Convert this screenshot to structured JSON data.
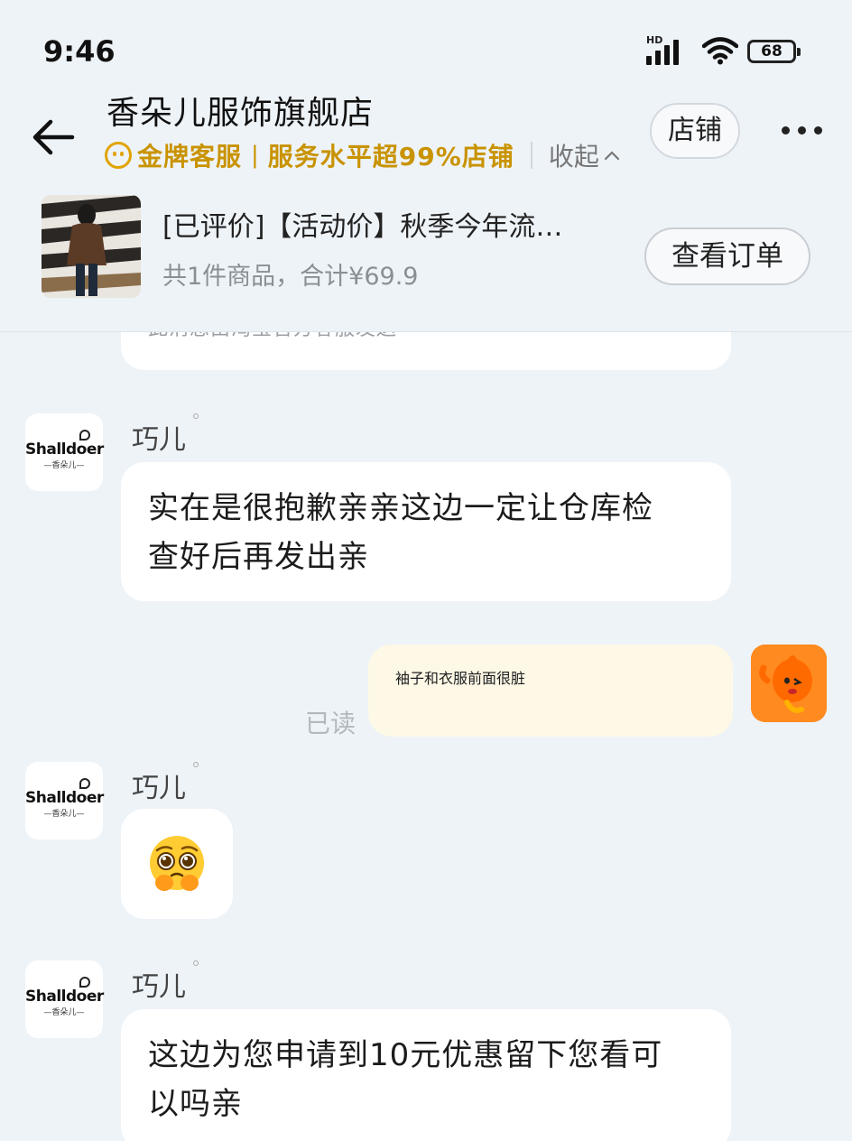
{
  "status_bar": {
    "time": "9:46",
    "network_label": "HD",
    "battery": "68"
  },
  "header": {
    "shop_name": "香朵儿服饰旗舰店",
    "badge_primary": "金牌客服",
    "badge_separator": "|",
    "badge_secondary": "服务水平超99%店铺",
    "collapse_label": "收起",
    "store_button": "店铺"
  },
  "order": {
    "title": "[已评价]【活动价】秋季今年流…",
    "summary": "共1件商品，合计¥69.9",
    "view_button": "查看订单"
  },
  "chat": {
    "notice_partial": "此消息由淘宝官方客服发送",
    "shop_avatar_brand": "Shalldoer",
    "shop_avatar_sub": "—香朵儿—",
    "messages": [
      {
        "sender": "巧儿",
        "lines": [
          "实在是很抱歉亲亲这边一定让仓库检",
          "查好后再发出亲"
        ]
      },
      {
        "sender": "me",
        "text": "袖子和衣服前面很脏",
        "status": "已读"
      },
      {
        "sender": "巧儿",
        "emoji": "pleading-face"
      },
      {
        "sender": "巧儿",
        "lines": [
          "这边为您申请到10元优惠留下您看可",
          "以吗亲"
        ]
      }
    ]
  },
  "colors": {
    "background": "#eef3f8",
    "gold_badge": "#c99300",
    "my_bubble": "#fdf9e6",
    "read_status": "#b3b8bf"
  }
}
